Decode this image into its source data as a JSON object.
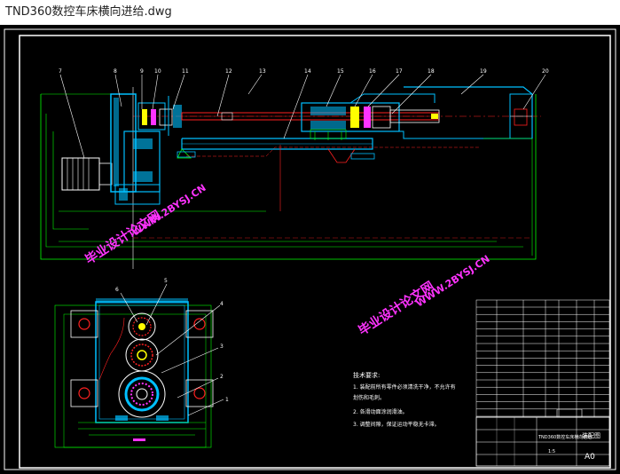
{
  "window": {
    "title": "TND360数控车床横向进给.dwg"
  },
  "callouts_top": [
    "7",
    "8",
    "9",
    "10",
    "11",
    "12",
    "13",
    "14",
    "15",
    "16",
    "17",
    "18",
    "19",
    "20"
  ],
  "callouts_bottom": [
    "6",
    "5",
    "4",
    "3",
    "2",
    "1"
  ],
  "watermark": {
    "brand": "毕业设计论文网",
    "site": "WWW.2BYSJ.CN"
  },
  "notes": {
    "heading": "技术要求:",
    "lines": [
      "1. 装配前所有零件必须清洗干净，不允许有",
      "划伤和毛刺。",
      "2. 各滑动面涂润滑油。",
      "3. 调整间隙，保证运动平稳无卡滞。"
    ]
  },
  "title_block": {
    "drawing_name": "TND360数控车床横向进给",
    "sheet_size": "A0",
    "label": "装配图",
    "scale": "1:5"
  },
  "colors": {
    "background": "#000000",
    "outline": "#00ff00",
    "section": "#00bfff",
    "white": "#ffffff",
    "red": "#ff2020",
    "yellow": "#ffff00",
    "magenta": "#ff33ff"
  }
}
